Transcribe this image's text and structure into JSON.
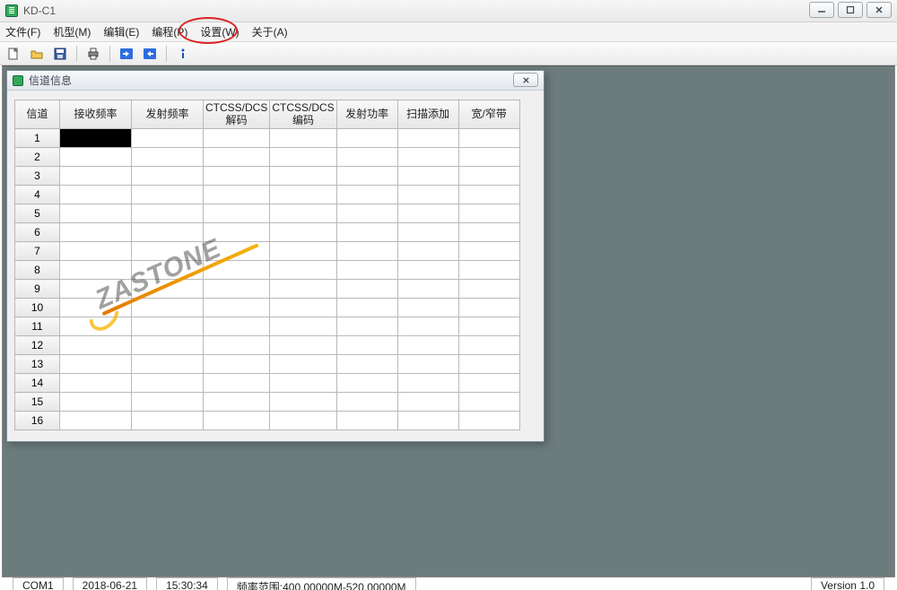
{
  "app": {
    "title": "KD-C1"
  },
  "menu": {
    "file": "文件(F)",
    "model": "机型(M)",
    "edit": "编辑(E)",
    "program": "编程(P)",
    "settings": "设置(W)",
    "about": "关于(A)"
  },
  "toolbar_icons": {
    "new": "new-file-icon",
    "open": "open-folder-icon",
    "save": "save-icon",
    "print": "print-icon",
    "read": "read-from-radio-icon",
    "write": "write-to-radio-icon",
    "info": "info-icon"
  },
  "child_window": {
    "title": "信道信息"
  },
  "table": {
    "columns": [
      "信道",
      "接收频率",
      "发射频率",
      "CTCSS/DCS\n解码",
      "CTCSS/DCS\n编码",
      "发射功率",
      "扫描添加",
      "宽/窄带"
    ],
    "row_count": 16,
    "selected_row": 1,
    "selected_col": 1
  },
  "watermark": {
    "text": "ZASTONE"
  },
  "status": {
    "port": "COM1",
    "date": "2018-06-21",
    "time": "15:30:34",
    "freq_range": "频率范围:400.00000M-520.00000M",
    "version": "Version 1.0"
  }
}
